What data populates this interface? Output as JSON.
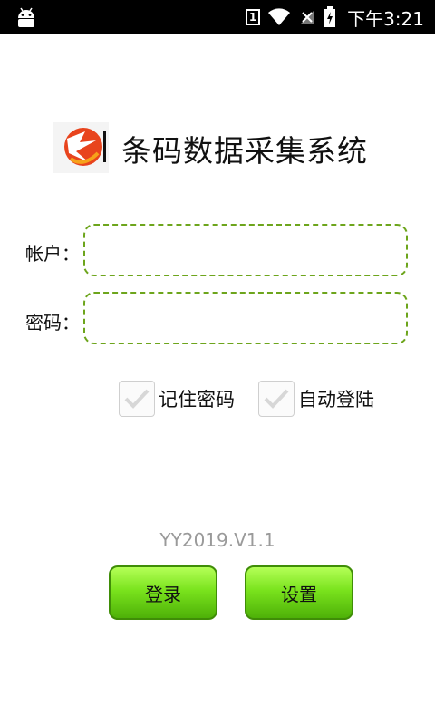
{
  "status_bar": {
    "sim_indicator": "1",
    "time": "下午3:21",
    "icons": [
      "android-icon",
      "sim-icon",
      "wifi-icon",
      "no-signal-icon",
      "battery-charging-icon"
    ]
  },
  "header": {
    "title": "条码数据采集系统"
  },
  "form": {
    "account_label": "帐户：",
    "account_value": "",
    "password_label": "密码：",
    "password_value": ""
  },
  "options": {
    "remember_password": "记住密码",
    "auto_login": "自动登陆"
  },
  "version": "YY2019.V1.1",
  "buttons": {
    "login": "登录",
    "settings": "设置"
  },
  "colors": {
    "field_border": "#6da51c",
    "button_green": "#7ae31d"
  }
}
